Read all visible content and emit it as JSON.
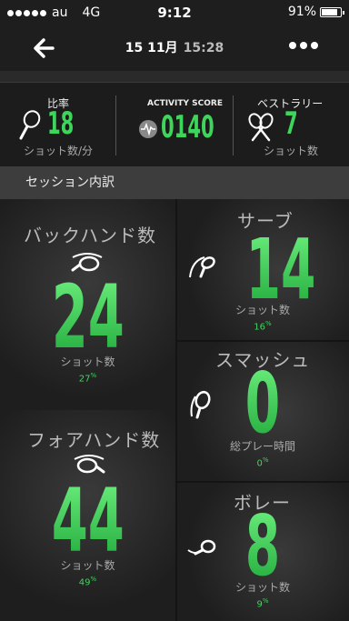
{
  "status": {
    "carrier": "au",
    "network": "4G",
    "time": "9:12",
    "battery": "91%",
    "battery_level": 0.91
  },
  "nav": {
    "date": "15 11月",
    "time": "15:28"
  },
  "summary": {
    "rate": {
      "label": "比率",
      "value": "18",
      "sub": "ショット数/分"
    },
    "activity": {
      "label": "ACTIVITY SCORE",
      "value": "0140"
    },
    "rally": {
      "label": "ベストラリー",
      "value": "7",
      "sub": "ショット数"
    }
  },
  "section": {
    "title": "セッション内訳"
  },
  "tiles": {
    "backhand": {
      "title": "バックハンド数",
      "value": "24",
      "unit": "ショット数",
      "pct": "27"
    },
    "serve": {
      "title": "サーブ",
      "value": "14",
      "unit": "ショット数",
      "pct": "16"
    },
    "smash": {
      "title": "スマッシュ",
      "value": "0",
      "unit": "総プレー時間",
      "pct": "0"
    },
    "forehand": {
      "title": "フォアハンド数",
      "value": "44",
      "unit": "ショット数",
      "pct": "49"
    },
    "volley": {
      "title": "ボレー",
      "value": "8",
      "unit": "ショット数",
      "pct": "9"
    }
  },
  "pct_symbol": "%"
}
